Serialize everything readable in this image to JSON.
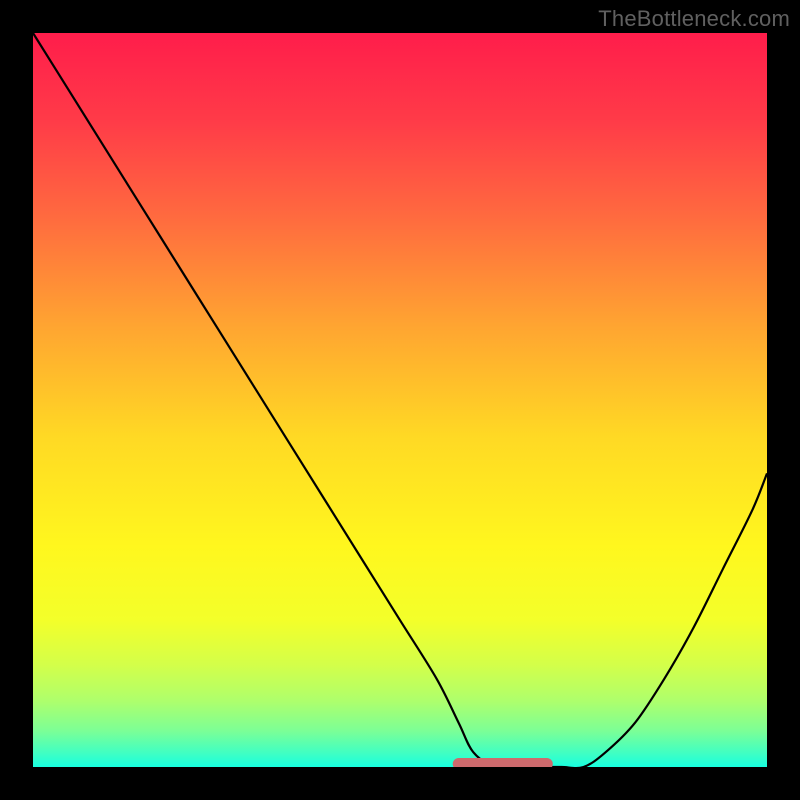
{
  "watermark": "TheBottleneck.com",
  "chart_data": {
    "type": "line",
    "title": "",
    "xlabel": "",
    "ylabel": "",
    "xlim": [
      0,
      100
    ],
    "ylim": [
      0,
      100
    ],
    "x": [
      0,
      5,
      10,
      15,
      20,
      25,
      30,
      35,
      40,
      45,
      50,
      55,
      58,
      60,
      63,
      66,
      69,
      72,
      75,
      78,
      82,
      86,
      90,
      94,
      98,
      100
    ],
    "values": [
      100,
      92,
      84,
      76,
      68,
      60,
      52,
      44,
      36,
      28,
      20,
      12,
      6,
      2,
      0,
      0,
      0,
      0,
      0,
      2,
      6,
      12,
      19,
      27,
      35,
      40
    ],
    "curve_stroke": "#000000",
    "marker": {
      "x_start": 58,
      "x_end": 70,
      "y": 0,
      "stroke": "#cd6a6d",
      "width": 12
    },
    "background": {
      "type": "vertical-gradient",
      "stops": [
        {
          "offset": 0.0,
          "color": "#ff1d4b"
        },
        {
          "offset": 0.12,
          "color": "#ff3b48"
        },
        {
          "offset": 0.25,
          "color": "#ff6a3f"
        },
        {
          "offset": 0.4,
          "color": "#ffa531"
        },
        {
          "offset": 0.55,
          "color": "#ffd924"
        },
        {
          "offset": 0.7,
          "color": "#fff71e"
        },
        {
          "offset": 0.8,
          "color": "#f3ff2a"
        },
        {
          "offset": 0.86,
          "color": "#d4ff49"
        },
        {
          "offset": 0.91,
          "color": "#aeff6c"
        },
        {
          "offset": 0.95,
          "color": "#7dff95"
        },
        {
          "offset": 0.98,
          "color": "#42ffc1"
        },
        {
          "offset": 1.0,
          "color": "#18ffe0"
        }
      ]
    }
  }
}
